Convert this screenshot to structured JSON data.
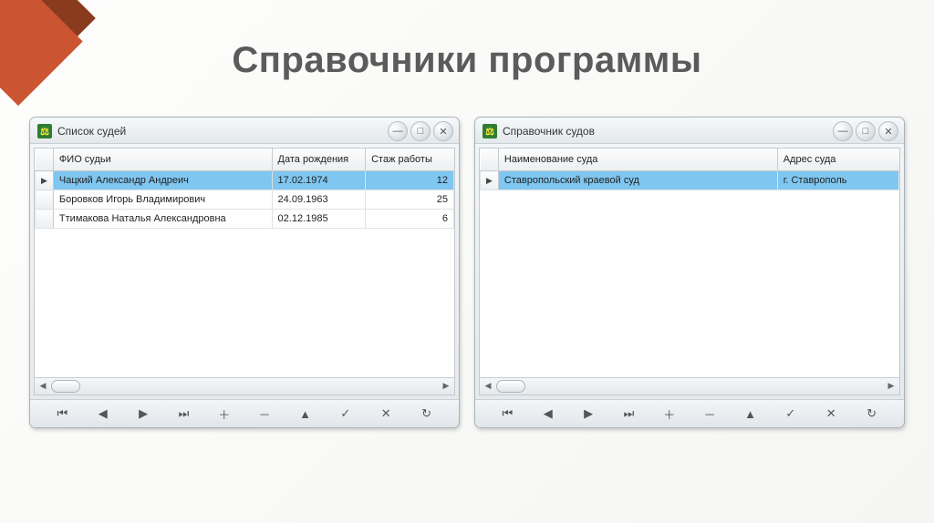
{
  "title": "Справочники программы",
  "window1": {
    "title": "Список судей",
    "columns": [
      "ФИО судьи",
      "Дата рождения",
      "Стаж работы"
    ],
    "rows": [
      {
        "selected": true,
        "marker": "▶",
        "name": "Чацкий Александр Андреич",
        "dob": "17.02.1974",
        "exp": "12"
      },
      {
        "selected": false,
        "marker": "",
        "name": "Боровков Игорь Владимирович",
        "dob": "24.09.1963",
        "exp": "25"
      },
      {
        "selected": false,
        "marker": "",
        "name": "Ттимакова Наталья Александровна",
        "dob": "02.12.1985",
        "exp": "6"
      }
    ]
  },
  "window2": {
    "title": "Справочник судов",
    "columns": [
      "Наименование суда",
      "Адрес суда"
    ],
    "rows": [
      {
        "selected": true,
        "marker": "▶",
        "court": "Ставропольский краевой суд",
        "addr": "г. Ставрополь"
      }
    ]
  },
  "nav": {
    "first": "⏮",
    "prev": "◀",
    "next": "▶",
    "last": "⏭",
    "add": "＋",
    "remove": "－",
    "edit": "▲",
    "ok": "✓",
    "cancel": "✕",
    "refresh": "↻"
  },
  "winctrl": {
    "min": "—",
    "max": "□",
    "close": "✕"
  }
}
